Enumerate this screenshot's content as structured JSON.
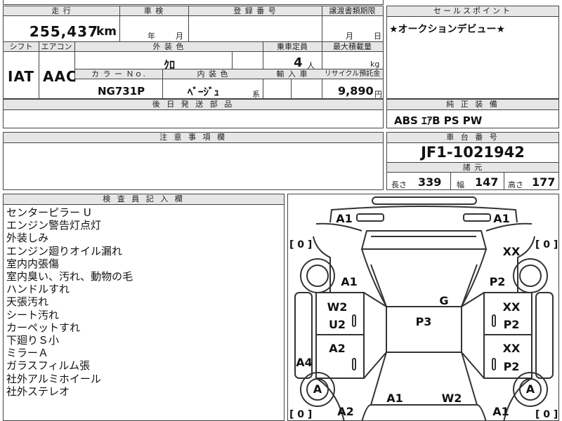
{
  "top_left": {
    "mileage_label": "走 行",
    "mileage_value": "255,437",
    "mileage_unit": "km",
    "inspection_label": "車 検",
    "inspection_year": "年",
    "inspection_month": "月",
    "registration_label": "登 録 番 号",
    "transfer_label": "譲渡書類期限",
    "transfer_month": "月",
    "transfer_day": "日",
    "shift_label": "シフト",
    "shift_value": "IAT",
    "aircon_label": "エアコン",
    "aircon_value": "AAC",
    "exterior_label": "外 装 色",
    "exterior_value": "ｸﾛ",
    "capacity_label": "乗車定員",
    "capacity_value": "4",
    "capacity_unit": "人",
    "max_load_label": "最大積載量",
    "max_load_unit": "kg",
    "color_no_label": "カ ラ ー Ｎｏ.",
    "color_no_value": "NG731P",
    "interior_label": "内 装 色",
    "interior_value": "ﾍﾞｰｼﾞｭ",
    "interior_suffix": "系",
    "import_label": "輸 入 車",
    "recycle_label": "リサイクル預託金",
    "recycle_value": "9,890",
    "recycle_unit": "円",
    "later_parts_label": "後 日 発 送 部 品"
  },
  "sales_point": {
    "label": "セールスポイント",
    "text": "★オークションデビュー★"
  },
  "genuine_equipment": {
    "label": "純 正 装 備",
    "text": "ABS ｴｱB PS PW"
  },
  "caution": {
    "label": "注 意 事 項 欄"
  },
  "chassis": {
    "label": "車 台 番 号",
    "number": "JF1-1021942",
    "spec_label": "諸 元",
    "length_label": "長さ",
    "length_value": "339",
    "width_label": "幅",
    "width_value": "147",
    "height_label": "高さ",
    "height_value": "177"
  },
  "inspector": {
    "label": "検 査 員 記 入 欄",
    "notes": [
      "センターピラー U",
      "エンジン警告灯点灯",
      "外装しみ",
      "エンジン廻りオイル漏れ",
      "室内内張傷",
      "室内臭い、汚れ、動物の毛",
      "ハンドルすれ",
      "天張汚れ",
      "シート汚れ",
      "カーペットすれ",
      "下廻りＳ小",
      "ミラーＡ",
      "ガラスフィルム張",
      "社外アルミホイール",
      "社外ステレオ"
    ]
  },
  "diagram": {
    "codes": [
      {
        "label": "A1",
        "pos": "hood-left"
      },
      {
        "label": "A1",
        "pos": "hood-right"
      },
      {
        "label": "[ 0 ]",
        "pos": "bracket-left-top"
      },
      {
        "label": "[ 0 ]",
        "pos": "bracket-right-top"
      },
      {
        "label": "XX",
        "pos": "front-right-fender"
      },
      {
        "label": "A1",
        "pos": "front-left-fender"
      },
      {
        "label": "P2",
        "pos": "front-right-door"
      },
      {
        "label": "G",
        "pos": "windshield"
      },
      {
        "label": "W2",
        "pos": "left-door-window"
      },
      {
        "label": "U2",
        "pos": "left-door"
      },
      {
        "label": "P3",
        "pos": "roof"
      },
      {
        "label": "XX",
        "pos": "right-door-window"
      },
      {
        "label": "P2",
        "pos": "right-door"
      },
      {
        "label": "A2",
        "pos": "left-rear-door"
      },
      {
        "label": "XX",
        "pos": "right-rear-door-window"
      },
      {
        "label": "P2",
        "pos": "right-rear-door"
      },
      {
        "label": "A4",
        "pos": "left-rocker"
      },
      {
        "label": "A",
        "pos": "left-front-wheel"
      },
      {
        "label": "A",
        "pos": "right-front-wheel"
      },
      {
        "label": "A1",
        "pos": "rear-left"
      },
      {
        "label": "W2",
        "pos": "rear-window"
      },
      {
        "label": "A2",
        "pos": "rear-left-quarter"
      },
      {
        "label": "A1",
        "pos": "rear-right-quarter"
      },
      {
        "label": "[ 0 ]",
        "pos": "bracket-left-bottom"
      },
      {
        "label": "[ 0 ]",
        "pos": "bracket-right-bottom"
      }
    ]
  }
}
